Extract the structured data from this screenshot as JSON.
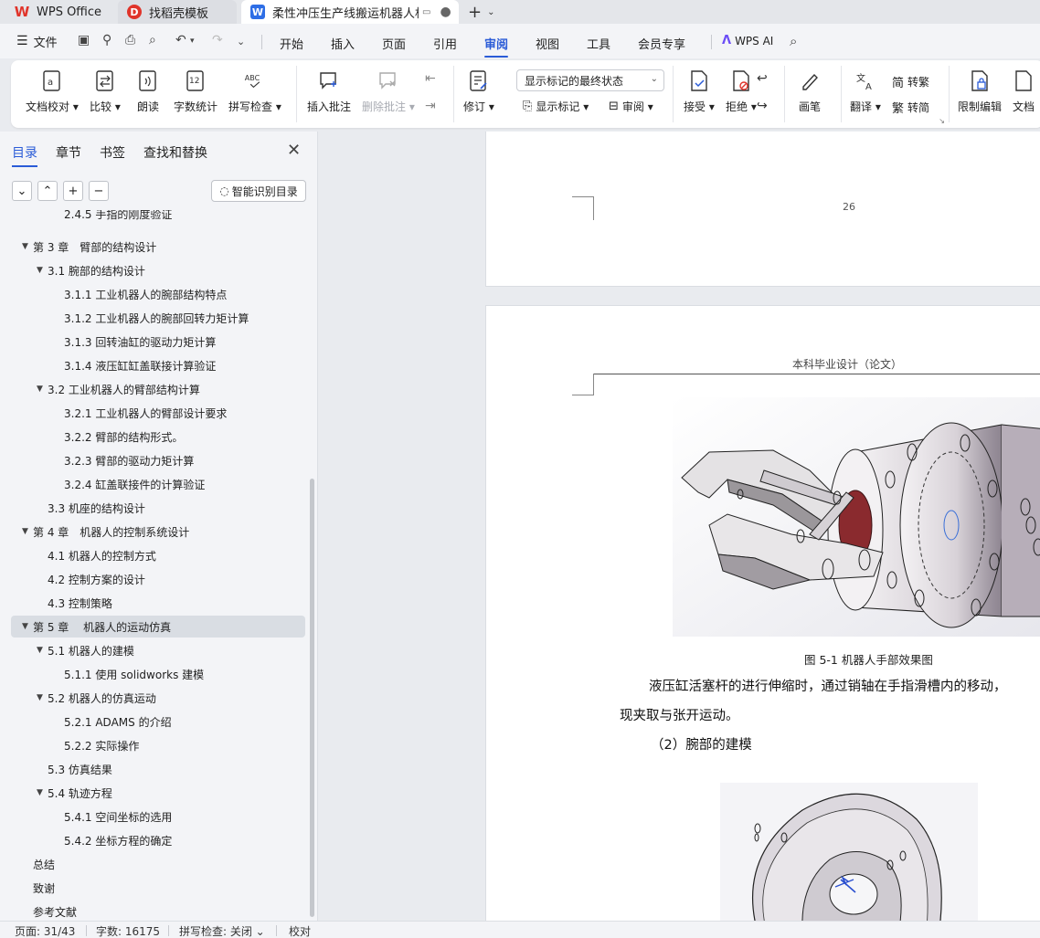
{
  "tabs": [
    {
      "label": "WPS Office",
      "icon": "wps-logo-icon"
    },
    {
      "label": "找稻壳模板",
      "icon": "docer-icon"
    },
    {
      "label": "柔性冲压生产线搬运机器人机械",
      "icon": "writer-doc-icon",
      "active": true
    }
  ],
  "menubar": {
    "file_label": "文件",
    "items": [
      "开始",
      "插入",
      "页面",
      "引用",
      "审阅",
      "视图",
      "工具",
      "会员专享"
    ],
    "active": "审阅",
    "wps_ai": "WPS AI"
  },
  "ribbon": {
    "doc_check": "文档校对",
    "compare": "比较",
    "read_aloud": "朗读",
    "word_count": "字数统计",
    "spell_check": "拼写检查",
    "insert_comment": "插入批注",
    "delete_comment": "删除批注",
    "track_changes": "修订",
    "markup_dropdown": "显示标记的最终状态",
    "show_markup": "显示标记",
    "review": "审阅",
    "accept": "接受",
    "reject": "拒绝",
    "ink": "画笔",
    "translate": "翻译",
    "to_traditional": "转繁",
    "to_simplified": "转简",
    "restrict_edit": "限制编辑",
    "doc_partial": "文档"
  },
  "nav": {
    "tabs": [
      "目录",
      "章节",
      "书签",
      "查找和替换"
    ],
    "active_tab": "目录",
    "smart_toc": "智能识别目录",
    "toc": [
      {
        "text": "2.4.5 手指的刚度验证",
        "level": 3,
        "partial": true
      },
      {
        "text": "第 3 章　臂部的结构设计",
        "level": 1,
        "expanded": true
      },
      {
        "text": "3.1  腕部的结构设计",
        "level": 2,
        "expanded": true
      },
      {
        "text": "3.1.1 工业机器人的腕部结构特点",
        "level": 3
      },
      {
        "text": "3.1.2 工业机器人的腕部回转力矩计算",
        "level": 3
      },
      {
        "text": "3.1.3  回转油缸的驱动力矩计算",
        "level": 3
      },
      {
        "text": "3.1.4  液压缸缸盖联接计算验证",
        "level": 3
      },
      {
        "text": "3.2  工业机器人的臂部结构计算",
        "level": 2,
        "expanded": true
      },
      {
        "text": "3.2.1 工业机器人的臂部设计要求",
        "level": 3
      },
      {
        "text": "3.2.2 臂部的结构形式。",
        "level": 3
      },
      {
        "text": "3.2.3 臂部的驱动力矩计算",
        "level": 3
      },
      {
        "text": "3.2.4 缸盖联接件的计算验证",
        "level": 3
      },
      {
        "text": "3.3  机座的结构设计",
        "level": 2
      },
      {
        "text": "第 4 章　机器人的控制系统设计",
        "level": 1,
        "expanded": true
      },
      {
        "text": "4.1 机器人的控制方式",
        "level": 2
      },
      {
        "text": "4.2 控制方案的设计",
        "level": 2
      },
      {
        "text": "4.3 控制策略",
        "level": 2
      },
      {
        "text": "第 5 章　 机器人的运动仿真",
        "level": 1,
        "expanded": true,
        "selected": true
      },
      {
        "text": "5.1 机器人的建模",
        "level": 2,
        "expanded": true
      },
      {
        "text": "5.1.1  使用 solidworks 建模",
        "level": 3
      },
      {
        "text": "5.2  机器人的仿真运动",
        "level": 2,
        "expanded": true
      },
      {
        "text": "5.2.1 ADAMS 的介绍",
        "level": 3
      },
      {
        "text": "5.2.2 实际操作",
        "level": 3
      },
      {
        "text": "5.3  仿真结果",
        "level": 2
      },
      {
        "text": "5.4  轨迹方程",
        "level": 2,
        "expanded": true
      },
      {
        "text": "5.4.1 空间坐标的选用",
        "level": 3
      },
      {
        "text": "5.4.2 坐标方程的确定",
        "level": 3
      },
      {
        "text": "总结",
        "level": 1
      },
      {
        "text": "致谢",
        "level": 1
      },
      {
        "text": "参考文献",
        "level": 1
      }
    ]
  },
  "document": {
    "prev_page_number": "26",
    "header": "本科毕业设计（论文）",
    "figure_caption": "图 5-1  机器人手部效果图",
    "paragraph_line1": "液压缸活塞杆的进行伸缩时，通过销轴在手指滑槽内的移动，",
    "paragraph_line2": "现夹取与张开运动。",
    "subheading": "（2）腕部的建模"
  },
  "status": {
    "page": "页面: 31/43",
    "words": "字数: 16175",
    "spell": "拼写检查: 关闭",
    "proof": "校对"
  },
  "colors": {
    "accent": "#2a5bd7",
    "wps_red": "#e0342a",
    "doc_blue": "#2e6ee6"
  }
}
